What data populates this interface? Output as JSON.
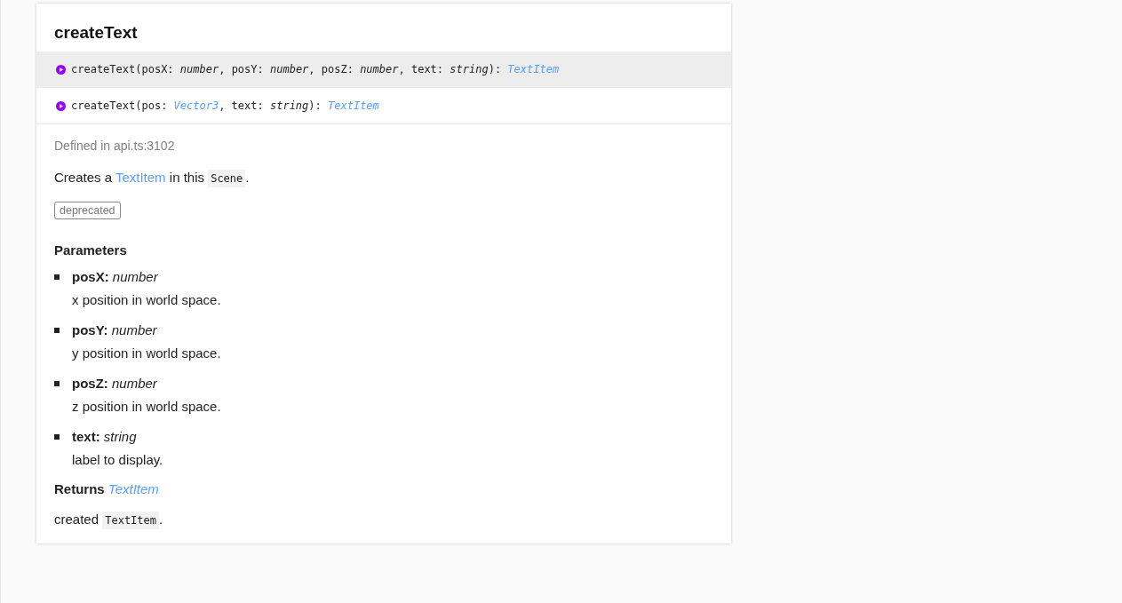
{
  "title": "createText",
  "signatures": [
    {
      "selected": true,
      "segments": [
        {
          "kind": "plain",
          "text": "createText(posX: "
        },
        {
          "kind": "type",
          "text": "number"
        },
        {
          "kind": "plain",
          "text": ", posY: "
        },
        {
          "kind": "type",
          "text": "number"
        },
        {
          "kind": "plain",
          "text": ", posZ: "
        },
        {
          "kind": "type",
          "text": "number"
        },
        {
          "kind": "plain",
          "text": ", text: "
        },
        {
          "kind": "type",
          "text": "string"
        },
        {
          "kind": "plain",
          "text": "): "
        },
        {
          "kind": "link",
          "text": "TextItem"
        }
      ]
    },
    {
      "selected": false,
      "segments": [
        {
          "kind": "plain",
          "text": "createText(pos: "
        },
        {
          "kind": "link",
          "text": "Vector3"
        },
        {
          "kind": "plain",
          "text": ", text: "
        },
        {
          "kind": "type",
          "text": "string"
        },
        {
          "kind": "plain",
          "text": "): "
        },
        {
          "kind": "link",
          "text": "TextItem"
        }
      ]
    }
  ],
  "defined_in": "Defined in api.ts:3102",
  "description": [
    {
      "kind": "plain",
      "text": "Creates a "
    },
    {
      "kind": "link",
      "text": "TextItem"
    },
    {
      "kind": "plain",
      "text": " in this "
    },
    {
      "kind": "code",
      "text": "Scene"
    },
    {
      "kind": "plain",
      "text": "."
    }
  ],
  "tag": "deprecated",
  "parameters_heading": "Parameters",
  "parameters": [
    {
      "name": "posX:",
      "type": "number",
      "description": "x position in world space."
    },
    {
      "name": "posY:",
      "type": "number",
      "description": "y position in world space."
    },
    {
      "name": "posZ:",
      "type": "number",
      "description": "z position in world space."
    },
    {
      "name": "text:",
      "type": "string",
      "description": "label to display."
    }
  ],
  "returns": {
    "label": "Returns",
    "type": "TextItem"
  },
  "returns_description": [
    {
      "kind": "plain",
      "text": "created "
    },
    {
      "kind": "code",
      "text": "TextItem"
    },
    {
      "kind": "plain",
      "text": "."
    }
  ]
}
